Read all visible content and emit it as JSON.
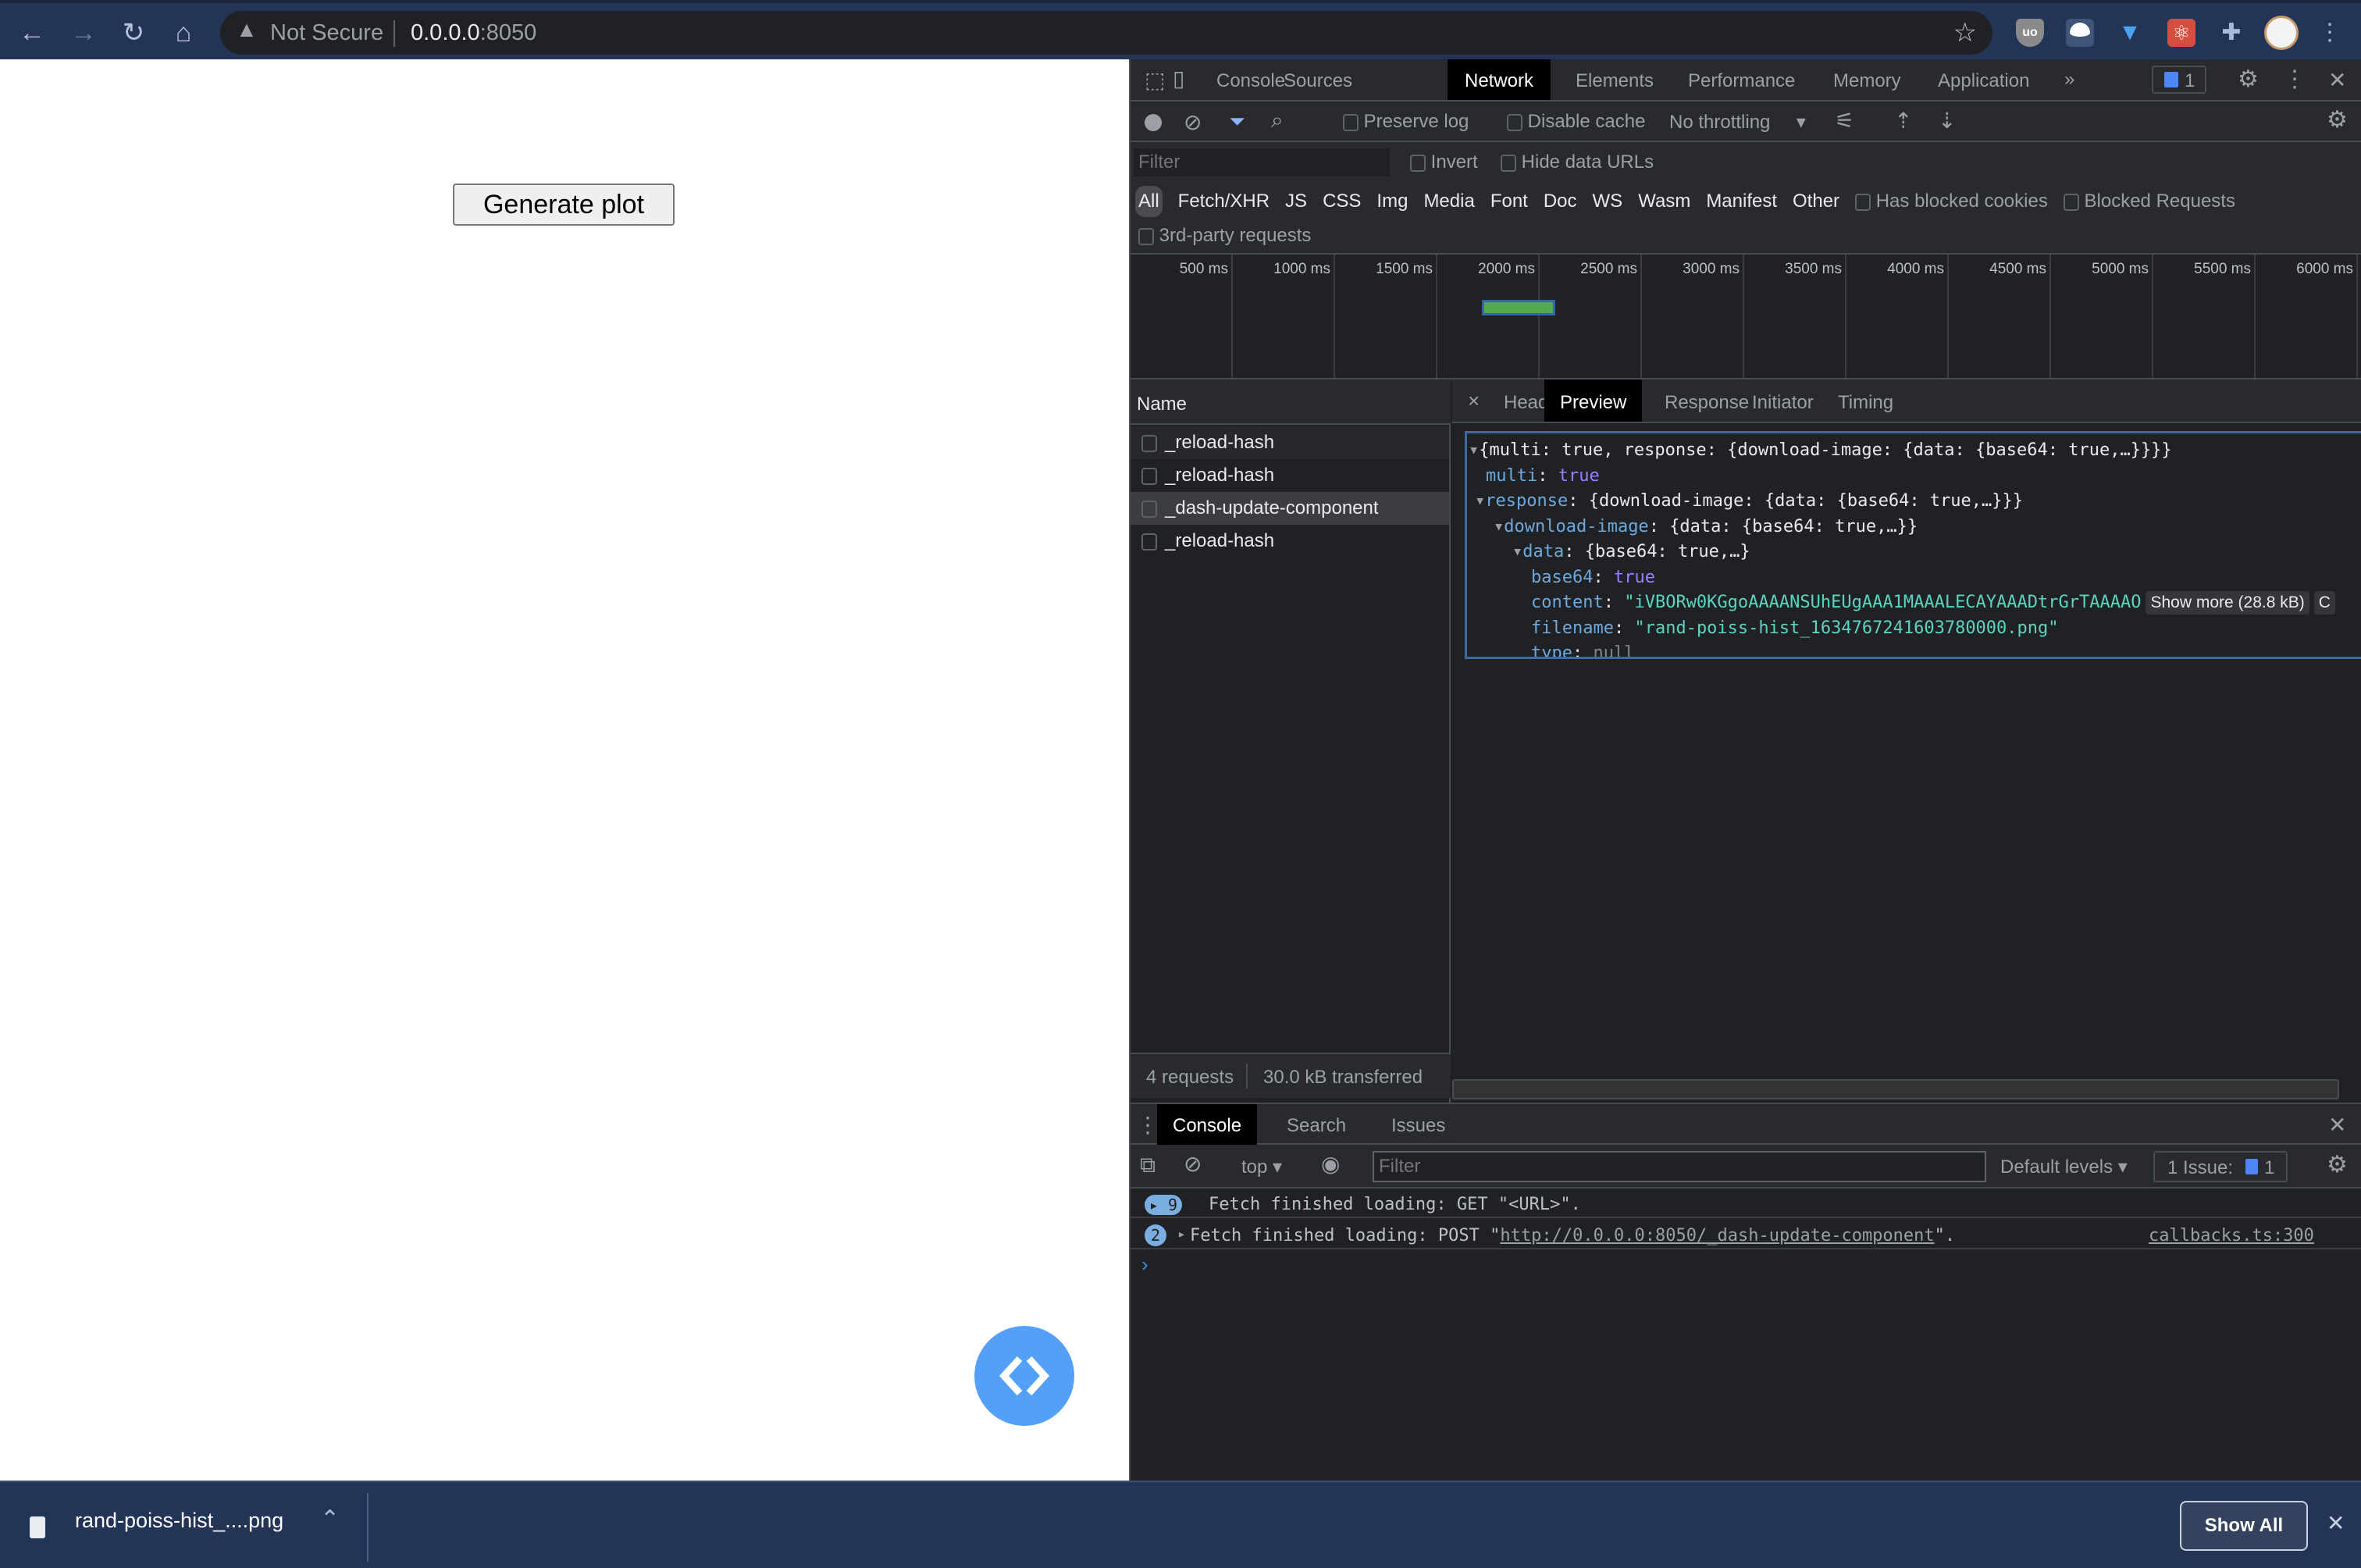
{
  "browser": {
    "security_label": "Not Secure",
    "url_host": "0.0.0.0",
    "url_port": ":8050",
    "icons": [
      "back-arrow-icon",
      "forward-arrow-icon",
      "reload-icon",
      "home-icon",
      "warning-icon",
      "star-icon",
      "ublock-origin-icon",
      "extension-wave-icon",
      "extension-diamond-icon",
      "react-devtools-icon",
      "puzzle-extensions-icon",
      "profile-avatar",
      "kebab-menu-icon"
    ]
  },
  "page": {
    "generate_button": "Generate plot",
    "debug_button_icon": "code-brackets-icon"
  },
  "devtools": {
    "main_tabs": [
      "Console",
      "Sources",
      "Network",
      "Elements",
      "Performance",
      "Memory",
      "Application"
    ],
    "active_tab": "Network",
    "more_tabs": "»",
    "issues_badge": "1",
    "toolbar": {
      "preserve_log": "Preserve log",
      "disable_cache": "Disable cache",
      "throttling": "No throttling"
    },
    "filter": {
      "placeholder": "Filter",
      "invert": "Invert",
      "hide_data_urls": "Hide data URLs",
      "types": [
        "All",
        "Fetch/XHR",
        "JS",
        "CSS",
        "Img",
        "Media",
        "Font",
        "Doc",
        "WS",
        "Wasm",
        "Manifest",
        "Other"
      ],
      "active_type": "All",
      "has_blocked_cookies": "Has blocked cookies",
      "blocked_requests": "Blocked Requests",
      "third_party": "3rd-party requests"
    },
    "timeline": {
      "ticks": [
        "500 ms",
        "1000 ms",
        "1500 ms",
        "2000 ms",
        "2500 ms",
        "3000 ms",
        "3500 ms",
        "4000 ms",
        "4500 ms",
        "5000 ms",
        "5500 ms",
        "6000 ms"
      ]
    },
    "requests": {
      "header": "Name",
      "rows": [
        "_reload-hash",
        "_reload-hash",
        "_dash-update-component",
        "_reload-hash"
      ],
      "selected_index": 2,
      "summary_count": "4 requests",
      "summary_transferred": "30.0 kB transferred"
    },
    "detail": {
      "close": "×",
      "tabs": [
        "Headers",
        "Preview",
        "Response",
        "Initiator",
        "Timing"
      ],
      "active_tab": "Preview",
      "preview": {
        "root_summary": "{multi: true, response: {download-image: {data: {base64: true,…}}}}",
        "multi_key": "multi",
        "multi_value": "true",
        "response_key": "response",
        "response_summary": "{download-image: {data: {base64: true,…}}}",
        "download_key": "download-image",
        "download_summary": "{data: {base64: true,…}}",
        "data_key": "data",
        "data_summary": "{base64: true,…}",
        "base64_key": "base64",
        "base64_value": "true",
        "content_key": "content",
        "content_value": "\"iVBORw0KGgoAAAANSUhEUgAAA1MAAALECAYAAADtrGrTAAAAO",
        "show_more": "Show more (28.8 kB)",
        "copy": "C",
        "filename_key": "filename",
        "filename_value": "\"rand-poiss-hist_1634767241603780000.png\"",
        "type_key": "type",
        "type_value": "null"
      }
    },
    "drawer": {
      "tabs": [
        "Console",
        "Search",
        "Issues"
      ],
      "active_tab": "Console",
      "context": "top",
      "filter_placeholder": "Filter",
      "levels": "Default levels",
      "issues_label": "1 Issue:",
      "issues_count": "1",
      "messages": [
        {
          "count": "9",
          "text": "Fetch finished loading: GET \"<URL>\"."
        },
        {
          "count": "2",
          "text_pre": "Fetch finished loading: POST \"",
          "link": "http://0.0.0.0:8050/_dash-update-component",
          "text_post": "\".",
          "source": "callbacks.ts:300"
        }
      ],
      "prompt": "›"
    }
  },
  "downloads": {
    "file": "rand-poiss-hist_....png",
    "show_all": "Show All",
    "close": "✕"
  }
}
